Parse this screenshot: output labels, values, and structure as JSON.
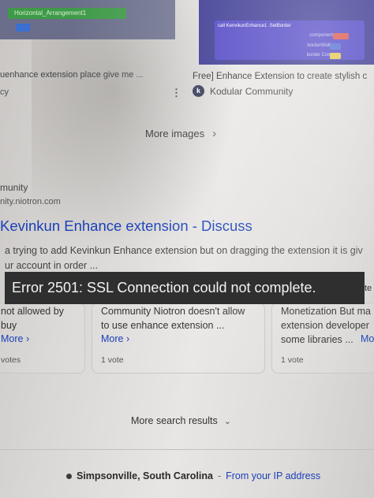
{
  "images": {
    "left": {
      "caption": "uenhance extension place give me ...",
      "source": "cy",
      "bar_label": "Horizontal_Arrangement1"
    },
    "right": {
      "caption": "Free] Enhance Extension to create stylish c",
      "source_logo": "k",
      "source": "Kodular Community",
      "code_rows": [
        "call KenvikunEnhance1 .SetBorder",
        "component",
        "borderWidth",
        "border Color"
      ]
    },
    "more_images_label": "More images"
  },
  "result": {
    "site": "munity",
    "url": "nity.niotron.com",
    "title": "Kevinkun Enhance extension - Discuss",
    "snippet_line1": "a trying to add Kevinkun Enhance extension but on dragging the extension it is giv",
    "snippet_line2": "ur account in order ..."
  },
  "error_toast": "Error 2501: SSL Connection could not complete.",
  "toast_tail": "te",
  "cards": [
    {
      "line1": "not allowed by",
      "line2": "buy",
      "more": "More",
      "votes": "votes"
    },
    {
      "line1": "Community Niotron doesn't allow",
      "line2": "to use enhance extension ...",
      "more": "More",
      "votes": "1 vote"
    },
    {
      "line1": "Monetization But ma",
      "line2": "extension developer",
      "line3": "some libraries ...",
      "more": "Mo",
      "votes": "1 vote"
    }
  ],
  "more_results_label": "More search results",
  "footer": {
    "city": "Simpsonville, South Carolina",
    "separator": " - ",
    "ip_link": "From your IP address"
  },
  "colors": {
    "link": "#1a3fb8",
    "toast_bg": "#2f2f2f"
  }
}
